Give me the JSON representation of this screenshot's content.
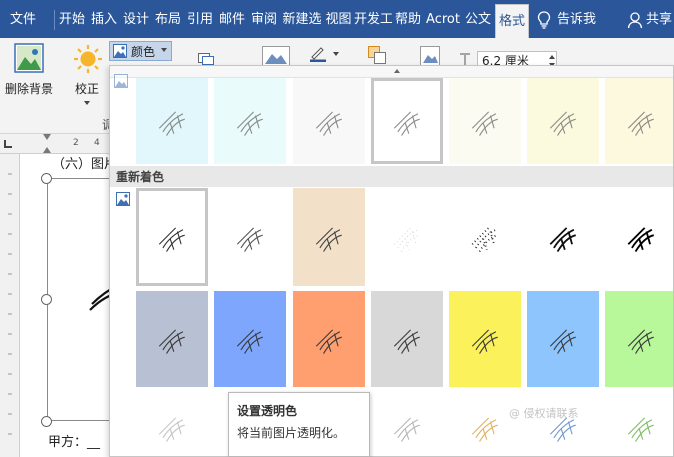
{
  "tabs": [
    {
      "label": "文件",
      "active": false
    },
    {
      "label": "开始",
      "active": false
    },
    {
      "label": "插入",
      "active": false
    },
    {
      "label": "设计",
      "active": false
    },
    {
      "label": "布局",
      "active": false
    },
    {
      "label": "引用",
      "active": false
    },
    {
      "label": "邮件",
      "active": false
    },
    {
      "label": "审阅",
      "active": false
    },
    {
      "label": "新建选",
      "active": false
    },
    {
      "label": "视图",
      "active": false
    },
    {
      "label": "开发工",
      "active": false
    },
    {
      "label": "帮助",
      "active": false
    },
    {
      "label": "Acrot",
      "active": false
    },
    {
      "label": "公文",
      "active": false
    },
    {
      "label": "格式",
      "active": true
    }
  ],
  "tell_me": {
    "label": "告诉我",
    "icon": "lightbulb-icon"
  },
  "share": {
    "label": "共享",
    "icon": "person-icon"
  },
  "ribbon": {
    "remove_bg_label": "删除背景",
    "correct_label": "校正",
    "color_label": "颜色",
    "group_fragment": "调",
    "size_value": "6.2 厘米"
  },
  "ruler_marks": [
    "2",
    "4"
  ],
  "doc_text": {
    "heading_fragment": "（六）图片",
    "signer_label": "甲方：__"
  },
  "gallery": {
    "recolor_title": "重新着色",
    "top_row": [
      {
        "tint": "#e2f7fb",
        "selected": false
      },
      {
        "tint": "#e9fbfa",
        "selected": false
      },
      {
        "tint": "#f8f8f8",
        "selected": false
      },
      {
        "tint": "#ffffff",
        "selected": true
      },
      {
        "tint": "#fbfbf1",
        "selected": false
      },
      {
        "tint": "#fbfadf",
        "selected": false
      },
      {
        "tint": "#fdf9df",
        "selected": false
      }
    ],
    "recolor_row1": [
      {
        "tint": "#ffffff",
        "selected": true
      },
      {
        "tint": "#ffffff",
        "selected": false
      },
      {
        "tint": "#f2e0c9",
        "selected": false
      },
      {
        "tint": "#ffffff",
        "selected": false
      },
      {
        "tint": "#ffffff",
        "selected": false
      },
      {
        "tint": "#ffffff",
        "selected": false
      },
      {
        "tint": "#ffffff",
        "selected": false
      }
    ],
    "recolor_row2": [
      {
        "tint": "#b7c1d3",
        "selected": false
      },
      {
        "tint": "#7ea6fc",
        "selected": false
      },
      {
        "tint": "#ff9e6e",
        "selected": false
      },
      {
        "tint": "#d8d8d8",
        "selected": false
      },
      {
        "tint": "#fbf25b",
        "selected": false
      },
      {
        "tint": "#8ec5fc",
        "selected": false
      },
      {
        "tint": "#b8f79a",
        "selected": false
      }
    ],
    "recolor_row3": [
      {
        "tint": "#ffffff",
        "selected": false
      },
      {
        "tint": "#ffffff",
        "selected": false
      },
      {
        "tint": "#ffffff",
        "selected": false
      },
      {
        "tint": "#ffffff",
        "selected": false
      },
      {
        "tint": "#ffffff",
        "selected": false
      },
      {
        "tint": "#ffffff",
        "selected": false
      },
      {
        "tint": "#ffffff",
        "selected": false
      }
    ]
  },
  "tooltip": {
    "title": "设置透明色",
    "desc": "将当前图片透明化。"
  },
  "watermark": "@ 侵权请联系"
}
